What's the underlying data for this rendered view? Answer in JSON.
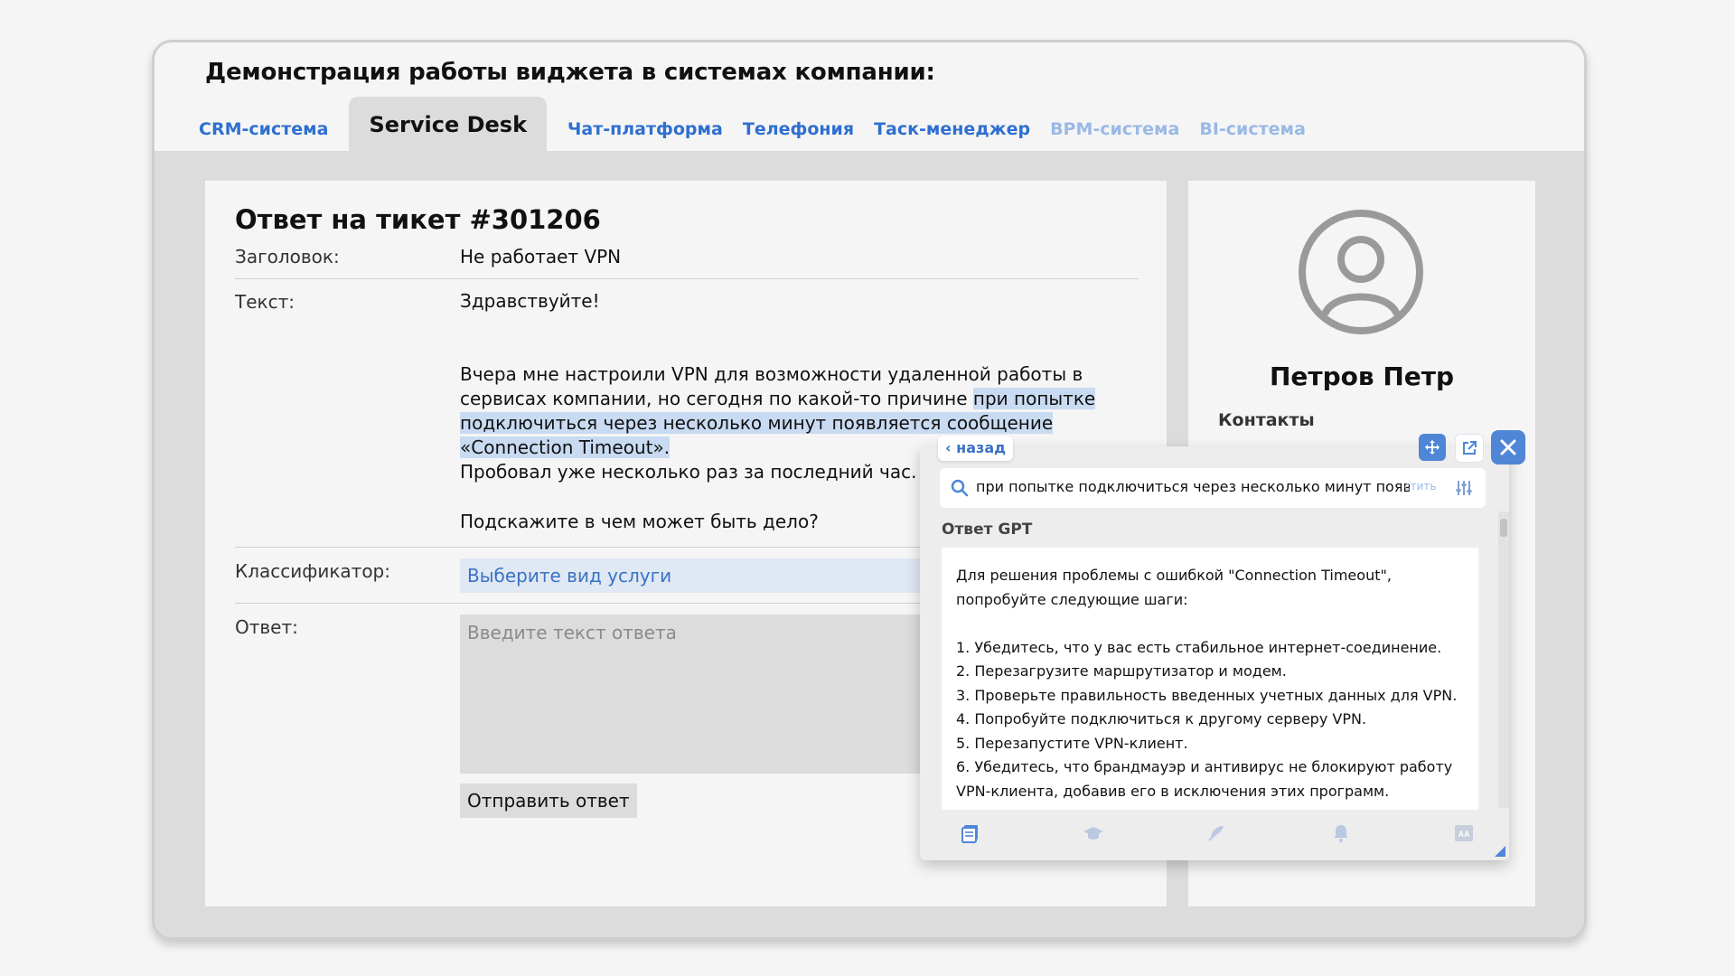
{
  "demo_title": "Демонстрация работы виджета в системах компании:",
  "tabs": [
    {
      "label": "CRM-система",
      "state": "normal"
    },
    {
      "label": "Service Desk",
      "state": "active"
    },
    {
      "label": "Чат-платформа",
      "state": "normal"
    },
    {
      "label": "Телефония",
      "state": "normal"
    },
    {
      "label": "Таск-менеджер",
      "state": "normal"
    },
    {
      "label": "BPM-система",
      "state": "dim"
    },
    {
      "label": "BI-система",
      "state": "dim"
    }
  ],
  "ticket": {
    "title": "Ответ на тикет #301206",
    "header_label": "Заголовок:",
    "header_value": "Не работает VPN",
    "text_label": "Текст:",
    "greeting": "Здравствуйте!",
    "body_pre": "Вчера мне настроили VPN для возможности удаленной работы в сервисах компании, но сегодня по какой-то причине ",
    "body_highlight": "при попытке подключиться через несколько минут появляется сообщение «Connection Timeout».",
    "body_post": "Пробовал уже несколько раз за последний час.",
    "question": "Подскажите в чем может быть дело?",
    "classifier_label": "Классификатор:",
    "classifier_placeholder": "Выберите вид услуги",
    "answer_label": "Ответ:",
    "answer_placeholder": "Введите текст ответа",
    "send_label": "Отправить ответ"
  },
  "side": {
    "person_name": "Петров Петр",
    "contacts_label": "Контакты"
  },
  "widget": {
    "back_label": "‹ назад",
    "search_query": "при попытке подключиться через несколько минут появляется",
    "search_clear": "стить",
    "gpt_label": "Ответ GPT",
    "answer_intro": "Для решения проблемы с ошибкой \"Connection Timeout\", попробуйте следующие шаги:",
    "steps": [
      "1. Убедитесь, что у вас есть стабильное интернет-соединение.",
      "2. Перезагрузите маршрутизатор и модем.",
      "3. Проверьте правильность введенных учетных данных для VPN.",
      "4. Попробуйте подключиться к другому серверу VPN.",
      "5. Перезапустите VPN-клиент.",
      "6. Убедитесь, что брандмауэр и антивирус не блокируют работу VPN-клиента, добавив его в исключения этих программ."
    ],
    "toolbar_icons": [
      "book-icon",
      "graduation-cap-icon",
      "feather-icon",
      "bell-icon",
      "font-size-icon"
    ]
  },
  "colors": {
    "accent": "#2f6fd0",
    "accent_dim": "#9ab9e6",
    "highlight": "#c9dbf2",
    "widget_button": "#4f86d6"
  }
}
